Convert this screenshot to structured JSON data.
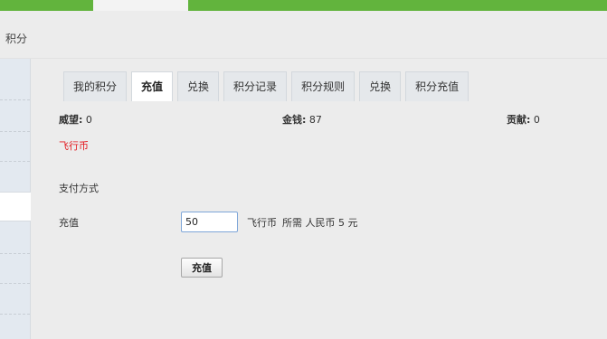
{
  "breadcrumb": {
    "current": "积分"
  },
  "tabs": [
    {
      "label": "我的积分",
      "active": false
    },
    {
      "label": "充值",
      "active": true
    },
    {
      "label": "兑换",
      "active": false
    },
    {
      "label": "积分记录",
      "active": false
    },
    {
      "label": "积分规则",
      "active": false
    },
    {
      "label": "兑换",
      "active": false
    },
    {
      "label": "积分充值",
      "active": false
    }
  ],
  "stats": {
    "prestige_label": "威望:",
    "prestige_value": "0",
    "money_label": "金钱:",
    "money_value": "87",
    "contribution_label": "贡献:",
    "contribution_value": "0"
  },
  "currency_name": "飞行币",
  "payment": {
    "method_label": "支付方式",
    "charge_label": "充值",
    "amount_value": "50",
    "unit": "飞行币",
    "cost_text": "所需 人民币 5 元",
    "submit_label": "充值"
  },
  "colors": {
    "topbar": "#62b43d",
    "currency": "#e3191f",
    "input_border": "#7ea6d8"
  }
}
